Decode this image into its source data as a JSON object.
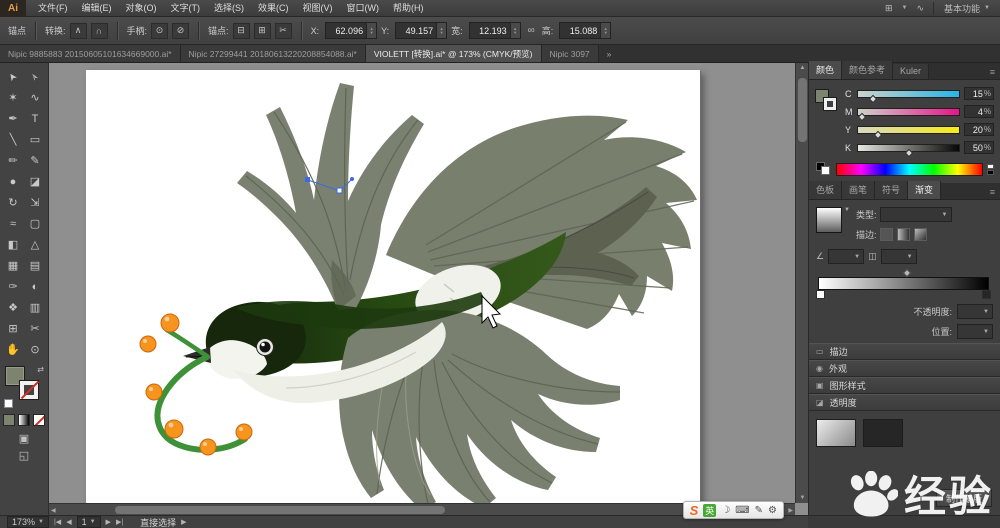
{
  "ui": {
    "caret": "▼",
    "spin_up": "▲",
    "spin_down": "▼",
    "panel_menu": "≡",
    "overflow": "»",
    "arrow_first": "|◀",
    "arrow_left": "◀",
    "arrow_right": "▶",
    "arrow_last": "▶|",
    "scroll_up": "▲",
    "scroll_down": "▼",
    "scroll_left": "◀",
    "scroll_right": "▶",
    "swap": "⇄",
    "link": "∞"
  },
  "menubar": {
    "logo": "Ai",
    "items": [
      "文件(F)",
      "编辑(E)",
      "对象(O)",
      "文字(T)",
      "选择(S)",
      "效果(C)",
      "视图(V)",
      "窗口(W)",
      "帮助(H)"
    ],
    "arrange_icon": "⊞",
    "extra_icon": "∿",
    "workspace": "基本功能"
  },
  "controlbar": {
    "mode_label": "锚点",
    "convert_label": "转换:",
    "convert_icons": [
      "∧",
      "∩"
    ],
    "handles_label": "手柄:",
    "handle_icons": [
      "⊙",
      "⊘"
    ],
    "anchors_label": "锚点:",
    "anchor_icons": [
      "⊟",
      "⊞",
      "✂"
    ],
    "fields": [
      {
        "label": "X:",
        "value": "62.096"
      },
      {
        "label": "Y:",
        "value": "49.157"
      },
      {
        "label": "宽:",
        "value": "12.193"
      },
      {
        "label": "高:",
        "value": "15.088"
      }
    ]
  },
  "tabbar": {
    "tabs": [
      {
        "label": "Nipic 9885883 20150605101634669000.ai*",
        "active": false
      },
      {
        "label": "Nipic 27299441 20180613220208854088.ai*",
        "active": false
      },
      {
        "label": "VIOLETT [转换].ai* @ 173% (CMYK/预览)",
        "active": true
      },
      {
        "label": "Nipic 3097",
        "active": false
      }
    ]
  },
  "toolbar": {
    "tools": [
      {
        "name": "selection",
        "glyph": "➤"
      },
      {
        "name": "direct-selection",
        "glyph": "➢"
      },
      {
        "name": "magic-wand",
        "glyph": "✶"
      },
      {
        "name": "lasso",
        "glyph": "∿"
      },
      {
        "name": "pen",
        "glyph": "✒"
      },
      {
        "name": "type",
        "glyph": "T"
      },
      {
        "name": "line-segment",
        "glyph": "╲"
      },
      {
        "name": "rectangle",
        "glyph": "▭"
      },
      {
        "name": "paintbrush",
        "glyph": "✏"
      },
      {
        "name": "pencil",
        "glyph": "✎"
      },
      {
        "name": "blob-brush",
        "glyph": "●"
      },
      {
        "name": "eraser",
        "glyph": "◪"
      },
      {
        "name": "rotate",
        "glyph": "↻"
      },
      {
        "name": "scale",
        "glyph": "⇲"
      },
      {
        "name": "width",
        "glyph": "≈"
      },
      {
        "name": "free-transform",
        "glyph": "▢"
      },
      {
        "name": "shape-builder",
        "glyph": "◧"
      },
      {
        "name": "perspective-grid",
        "glyph": "△"
      },
      {
        "name": "mesh",
        "glyph": "▦"
      },
      {
        "name": "gradient",
        "glyph": "▤"
      },
      {
        "name": "eyedropper",
        "glyph": "✑"
      },
      {
        "name": "blend",
        "glyph": "◐"
      },
      {
        "name": "symbol-sprayer",
        "glyph": "❖"
      },
      {
        "name": "column-graph",
        "glyph": "▥"
      },
      {
        "name": "artboard",
        "glyph": "⊞"
      },
      {
        "name": "slice",
        "glyph": "✂"
      },
      {
        "name": "hand",
        "glyph": "✋"
      },
      {
        "name": "zoom",
        "glyph": "⊙"
      }
    ],
    "extra": [
      {
        "name": "drawing-mode",
        "glyph": "▣"
      },
      {
        "name": "screen-mode",
        "glyph": "◱"
      }
    ]
  },
  "canvas": {
    "artwork_subject": "flying swallow carrying a green branch with orange berries"
  },
  "color_panel": {
    "tabs": [
      "颜色",
      "颜色参考",
      "Kuler"
    ],
    "unit": "%",
    "channels": [
      {
        "label": "C",
        "value": "15"
      },
      {
        "label": "M",
        "value": "4"
      },
      {
        "label": "Y",
        "value": "20"
      },
      {
        "label": "K",
        "value": "50"
      }
    ]
  },
  "swatch_row": {
    "tabs": [
      "色板",
      "画笔",
      "符号",
      "渐变"
    ]
  },
  "gradient_panel": {
    "type_label": "类型:",
    "stroke_label": "描边:",
    "angle_icon": "∠",
    "aspect_icon": "◫",
    "opacity_label": "不透明度:",
    "location_label": "位置:"
  },
  "sections": {
    "items": [
      {
        "label": "描边",
        "icon": "▭"
      },
      {
        "label": "外观",
        "icon": "◉"
      },
      {
        "label": "图形样式",
        "icon": "▣"
      },
      {
        "label": "透明度",
        "icon": "◪"
      }
    ],
    "make_mask": "制作蒙版"
  },
  "statusbar": {
    "zoom": "173%",
    "page": "1",
    "tool": "直接选择"
  },
  "ime": {
    "logo": "S",
    "lang": "英",
    "icons": [
      "☽",
      "⌨",
      "✎",
      "⚙"
    ]
  },
  "watermark": {
    "text": "经验"
  }
}
